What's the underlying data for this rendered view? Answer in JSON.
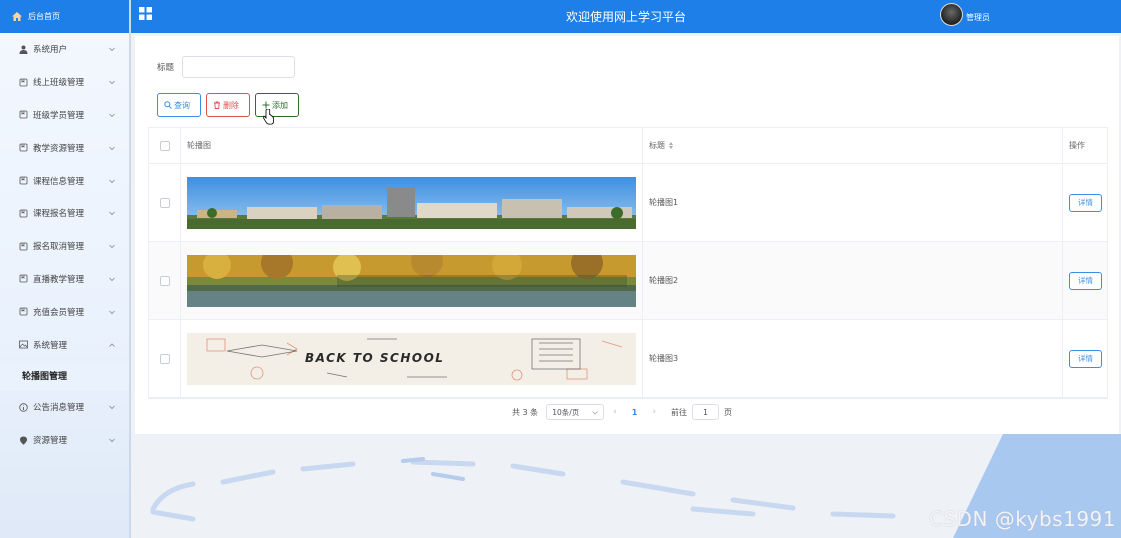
{
  "sidebar": {
    "home_label": "后台首页",
    "items": [
      {
        "label": "系统用户",
        "icon": "user-icon"
      },
      {
        "label": "线上班级管理",
        "icon": "doc-icon"
      },
      {
        "label": "班级学员管理",
        "icon": "doc-icon"
      },
      {
        "label": "教学资源管理",
        "icon": "doc-icon"
      },
      {
        "label": "课程信息管理",
        "icon": "doc-icon"
      },
      {
        "label": "课程报名管理",
        "icon": "doc-icon"
      },
      {
        "label": "报名取消管理",
        "icon": "doc-icon"
      },
      {
        "label": "直播教学管理",
        "icon": "doc-icon"
      },
      {
        "label": "充值会员管理",
        "icon": "doc-icon"
      },
      {
        "label": "系统管理",
        "icon": "picture-icon"
      }
    ],
    "sub_active": "轮播图管理",
    "items_after": [
      {
        "label": "公告消息管理",
        "icon": "info-icon"
      },
      {
        "label": "资源管理",
        "icon": "location-icon"
      }
    ]
  },
  "header": {
    "title": "欢迎使用网上学习平台",
    "user": "管理员",
    "color": "#1e7fe8"
  },
  "search": {
    "label": "标题",
    "value": "",
    "placeholder": ""
  },
  "toolbar": {
    "query_label": "查询",
    "delete_label": "删除",
    "add_label": "添加"
  },
  "table": {
    "headers": {
      "image": "轮播图",
      "title": "标题",
      "op": "操作"
    },
    "rows": [
      {
        "title": "轮播图1",
        "detail": "详情",
        "banner": "campus-aerial"
      },
      {
        "title": "轮播图2",
        "detail": "详情",
        "banner": "autumn-lake"
      },
      {
        "title": "轮播图3",
        "detail": "详情",
        "banner": "back-to-school"
      }
    ],
    "banner_text_row3": "BACK TO SCHOOL"
  },
  "pagination": {
    "total": "共 3 条",
    "page_size": "10条/页",
    "current": "1",
    "goto_label": "前往",
    "goto_value": "1",
    "page_suffix": "页"
  },
  "watermark": "CSDN @kybs1991"
}
